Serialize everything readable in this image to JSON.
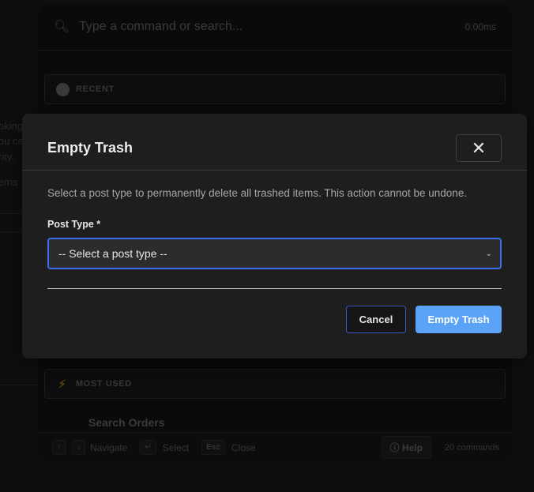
{
  "background_fragments": [
    "oking",
    "ou ca",
    "rity.",
    "ems"
  ],
  "palette": {
    "search_placeholder": "Type a command or search...",
    "timing": "0.00ms",
    "recent_label": "RECENT",
    "most_used_label": "MOST USED",
    "item_label": "Search Orders",
    "footer": {
      "up_key": "↑",
      "down_key": "↓",
      "navigate": "Navigate",
      "enter_key": "↵",
      "select": "Select",
      "esc_key": "Esc",
      "close": "Close",
      "help": "Help",
      "count": "20 commands"
    }
  },
  "modal": {
    "title": "Empty Trash",
    "description": "Select a post type to permanently delete all trashed items. This action cannot be undone.",
    "field_label": "Post Type *",
    "select_value": "-- Select a post type --",
    "cancel": "Cancel",
    "confirm": "Empty Trash",
    "accent_color": "#5aa3f6",
    "focus_color": "#3b6cf0"
  }
}
